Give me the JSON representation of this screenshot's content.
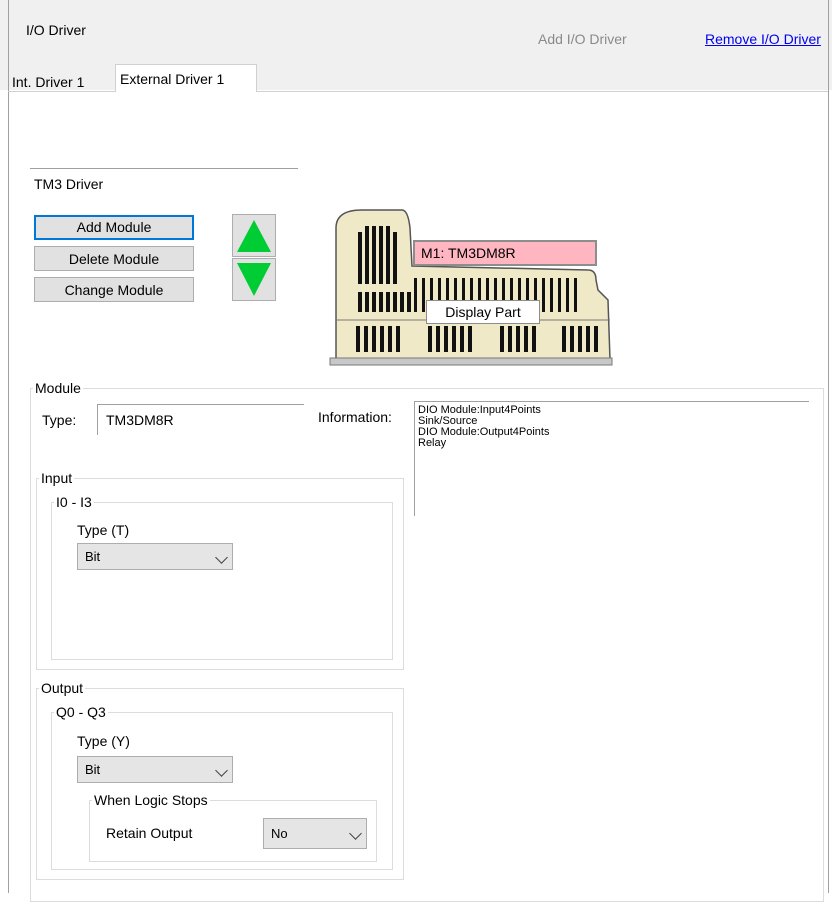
{
  "header": {
    "title": "I/O Driver",
    "add_link": "Add I/O Driver",
    "remove_link": "Remove I/O Driver"
  },
  "tabs": [
    {
      "label": "Int. Driver 1"
    },
    {
      "label": "External Driver 1"
    }
  ],
  "driver": {
    "name": "TM3 Driver"
  },
  "buttons": {
    "add": "Add Module",
    "delete": "Delete Module",
    "change": "Change Module"
  },
  "module_image": {
    "module_label": "M1: TM3DM8R",
    "display_label": "Display Part"
  },
  "module": {
    "legend": "Module",
    "type_label": "Type:",
    "type_value": "TM3DM8R",
    "info_label": "Information:",
    "info_text": "DIO Module:Input4Points\nSink/Source\nDIO Module:Output4Points\nRelay"
  },
  "input": {
    "legend": "Input",
    "range": "I0 - I3",
    "type_label": "Type (T)",
    "type_value": "Bit"
  },
  "output": {
    "legend": "Output",
    "range": "Q0 - Q3",
    "type_label": "Type (Y)",
    "type_value": "Bit",
    "logic_legend": "When Logic Stops",
    "retain_label": "Retain Output",
    "retain_value": "No"
  },
  "colors": {
    "arrow": "#00cc33",
    "highlight": "#ffb6c1",
    "module_body": "#efe9c8",
    "link": "#0000ee"
  }
}
